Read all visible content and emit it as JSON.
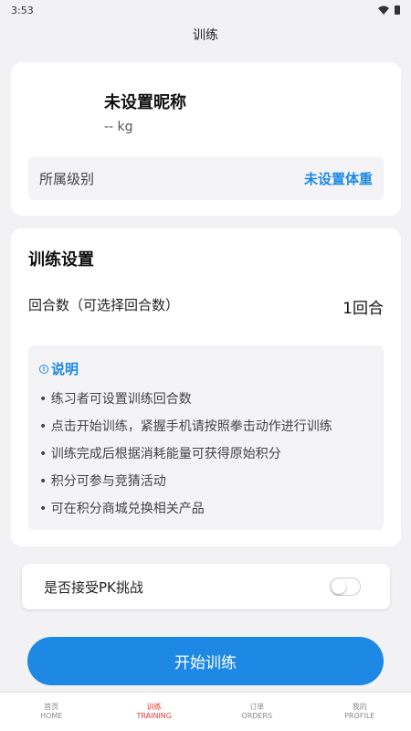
{
  "status_bar": {
    "time": "3:53"
  },
  "header": {
    "title": "训练"
  },
  "profile": {
    "nickname": "未设置昵称",
    "weight": "-- kg",
    "level_label": "所属级别",
    "level_value": "未设置体重"
  },
  "settings": {
    "title": "训练设置",
    "rounds_label": "回合数（可选择回合数）",
    "rounds_value": "1回合",
    "info_title": "说明",
    "info_items": [
      "• 练习者可设置训练回合数",
      "• 点击开始训练，紧握手机请按照拳击动作进行训练",
      "• 训练完成后根据消耗能量可获得原始积分",
      "• 积分可参与竞猜活动",
      "• 可在积分商城兑换相关产品"
    ]
  },
  "pk": {
    "label": "是否接受PK挑战",
    "enabled": false
  },
  "start_button": {
    "label": "开始训练"
  },
  "tabs": [
    {
      "label_cn": "首页",
      "label_en": "HOME",
      "active": false
    },
    {
      "label_cn": "训练",
      "label_en": "TRAINING",
      "active": true
    },
    {
      "label_cn": "订单",
      "label_en": "ORDERS",
      "active": false
    },
    {
      "label_cn": "我的",
      "label_en": "PROFILE",
      "active": false
    }
  ],
  "colors": {
    "accent": "#1e88e5",
    "active_tab": "#e53935"
  }
}
